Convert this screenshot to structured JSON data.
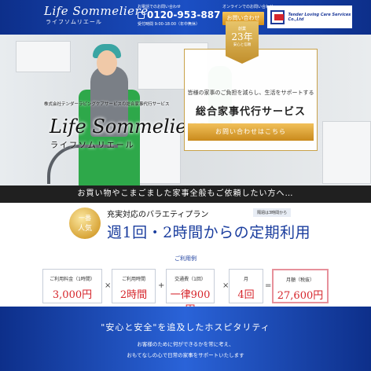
{
  "header": {
    "logo_en": "Life Sommeliere",
    "logo_jp": "ライフソムリエール",
    "phone_caption": "お電話でのお問い合わせ",
    "phone_number": "0120-953-887",
    "phone_hours": "受付時間 9:00-18:00（年中無休）",
    "online_caption": "オンラインでのお問い合わせ",
    "contact_button": "お問い合わせ",
    "company_name": "Tender Loving Care Services Co.,Ltd"
  },
  "hero": {
    "company_line": "株式会社テンダーラビングケアサービスの総合家事代行サービス",
    "brand_en": "Life Sommeliere",
    "brand_kana": "ライフソムリエール",
    "badge": {
      "top": "創業",
      "years": "23年",
      "bottom": "安心と信頼"
    },
    "card_text": "皆様の家事のご負担を減らし、生活をサポートする",
    "card_title": "総合家事代行サービス",
    "cta_button": "お問い合わせはこちら"
  },
  "band": {
    "text": "お買い物やこまごました家事全般もご依頼したい方へ…"
  },
  "plan": {
    "medal_top": "一番",
    "medal_bottom": "人気",
    "subtitle": "充実対応のバラエティプラン",
    "note": "隔週は3時間から",
    "title": "週1回・2時間からの定期利用",
    "example_label": "ご利用例",
    "items": [
      {
        "label": "ご利用料金（1時間）",
        "value": "3,000円"
      },
      {
        "label": "ご利用時間",
        "value": "2時間"
      },
      {
        "label": "交通費（1回）",
        "value": "一律900円"
      },
      {
        "label": "月",
        "value": "4回"
      },
      {
        "label": "月額（税抜）",
        "value": "27,600円"
      }
    ],
    "operators": [
      "×",
      "+",
      "×",
      "="
    ]
  },
  "footer": {
    "title": "\"安心と安全\"を追及したホスピタリティ",
    "line1": "お客様のために何ができるかを常に考え、",
    "line2": "おもてなしの心で日常の家事をサポートいたします"
  },
  "colors": {
    "accent_blue": "#1a3d9e",
    "gold": "#d68f18",
    "price_red": "#d6262c"
  }
}
